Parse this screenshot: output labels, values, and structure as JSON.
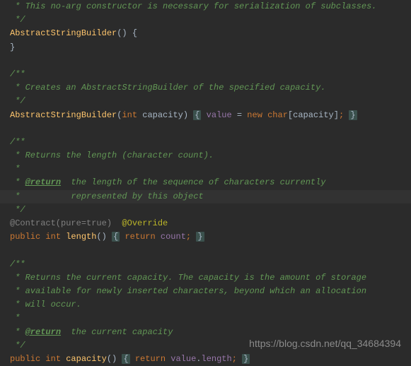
{
  "block1": {
    "line1": " * This no-arg constructor is necessary for serialization of subclasses.",
    "line2": " */",
    "ctor": "AbstractStringBuilder",
    "parens": "()",
    "openbrace": "{",
    "closebrace": "}"
  },
  "block2": {
    "c1": "/**",
    "c2": " * Creates an AbstractStringBuilder of the specified capacity.",
    "c3": " */",
    "ctor": "AbstractStringBuilder",
    "lp": "(",
    "ptype": "int",
    "pname": " capacity",
    "rp": ")",
    "ob": "{",
    "field": "value",
    "eq": " = ",
    "new": "new",
    "chartype": " char",
    "lb": "[",
    "cap": "capacity",
    "rb": "]",
    "semi": ";",
    "cb": "}"
  },
  "block3": {
    "c1": "/**",
    "c2": " * Returns the length (character count).",
    "c3": " *",
    "c4a": " * ",
    "c4tag": "@return",
    "c4b": "  the length of the sequence of characters currently",
    "c5": " *          represented by this object",
    "c6": " */",
    "contract": "@Contract(pure=true)",
    "anno": "  @Override",
    "pub": "public",
    "rtype": " int",
    "mname": " length",
    "parens": "()",
    "ob": "{",
    "ret": "return",
    "field": " count",
    "semi": ";",
    "cb": "}"
  },
  "block4": {
    "c1": "/**",
    "c2": " * Returns the current capacity. The capacity is the amount of storage",
    "c3": " * available for newly inserted characters, beyond which an allocation",
    "c4": " * will occur.",
    "c5": " *",
    "c6a": " * ",
    "c6tag": "@return",
    "c6b": "  the current capacity",
    "c7": " */",
    "pub": "public",
    "rtype": " int",
    "mname": " capacity",
    "parens": "()",
    "ob": "{",
    "ret": "return",
    "field": " value",
    "dot": ".",
    "len": "length",
    "semi": ";",
    "cb": "}"
  },
  "watermark": "https://blog.csdn.net/qq_34684394"
}
